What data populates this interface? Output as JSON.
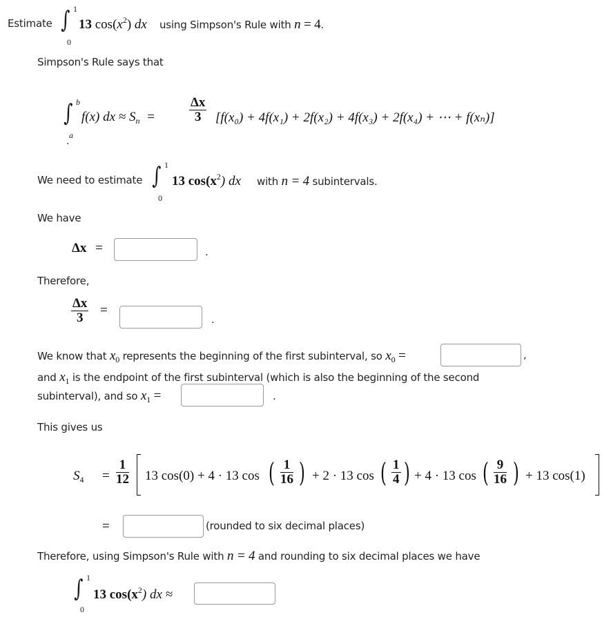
{
  "problem": {
    "prefix": "Estimate",
    "integral": {
      "lower": "0",
      "upper": "1",
      "integrand_coef": "13",
      "integrand_func": "cos",
      "integrand_arg": "x",
      "integrand_pow": "2",
      "dx": "dx"
    },
    "suffix": "using Simpson's Rule with",
    "n_var": "n",
    "equals": "=",
    "n_value": "4",
    "period": "."
  },
  "intro": "Simpson's Rule says that",
  "rule_formula": {
    "lower": "a",
    "upper": "b",
    "lhs": "f(x) dx ≈ S",
    "lhs_sub": "n",
    "eq": "=",
    "frac_num": "Δx",
    "frac_den": "3",
    "terms": "[f(x₀) + 4f(x₁) + 2f(x₂) + 4f(x₃) + 2f(x₄) + ⋯ + f(xₙ)]",
    "trailing": "."
  },
  "need": {
    "prefix": "We need to estimate",
    "integral": {
      "lower": "0",
      "upper": "1",
      "expr": "13 cos(x",
      "pow": "2",
      "close": ") dx"
    },
    "with": "with",
    "n_expr": "n = 4",
    "suffix": "subintervals."
  },
  "we_have": "We have",
  "delta_x": {
    "label": "Δx",
    "eq": "=",
    "value": "",
    "trailing": "."
  },
  "therefore": "Therefore,",
  "delta_x_over_3": {
    "num": "Δx",
    "den": "3",
    "eq": "=",
    "value": "",
    "trailing": "."
  },
  "x0_sentence": {
    "prefix": "We know that",
    "var": "x",
    "var_sub": "0",
    "text": "represents the beginning of the first subinterval, so",
    "eq": "=",
    "value": "",
    "trailing": ","
  },
  "x1_sentence": {
    "line1_prefix": "and",
    "var": "x",
    "var_sub": "1",
    "line1_text": "is the endpoint of the first subinterval (which is also the beginning of the second",
    "line2_text": "subinterval), and so",
    "eq": "=",
    "value": "",
    "trailing": "."
  },
  "gives_us": "This gives us",
  "s4": {
    "label": "S",
    "label_sub": "4",
    "eq": "=",
    "coef_num": "1",
    "coef_den": "12",
    "term1": "13 cos(0) + 4 · 13 cos",
    "frac1_num": "1",
    "frac1_den": "16",
    "term2": "+ 2 · 13 cos",
    "frac2_num": "1",
    "frac2_den": "4",
    "term3": "+ 4 · 13 cos",
    "frac3_num": "9",
    "frac3_den": "16",
    "term4": "+ 13 cos(1)",
    "result_eq": "=",
    "result_value": "",
    "result_note": "(rounded to six decimal places)"
  },
  "conclusion": {
    "prefix": "Therefore, using Simpson's Rule with",
    "n_expr": "n = 4",
    "suffix": "and rounding to six decimal places we have"
  },
  "final": {
    "lower": "0",
    "upper": "1",
    "expr": "13 cos(x",
    "pow": "2",
    "close": ") dx ≈",
    "value": ""
  }
}
